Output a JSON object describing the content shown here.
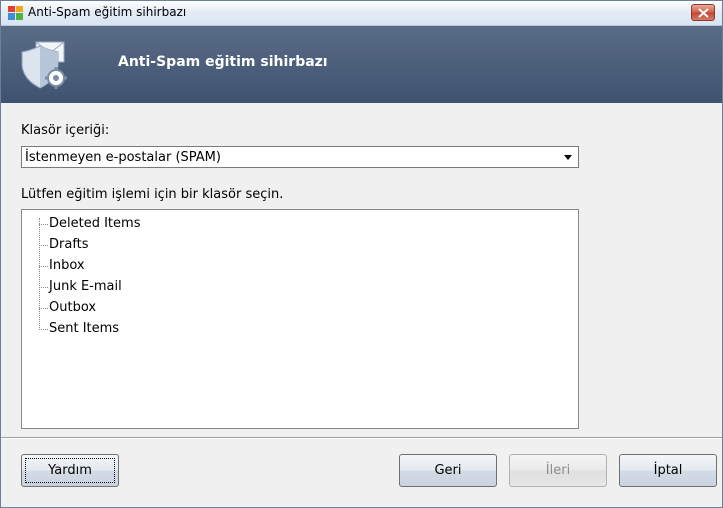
{
  "window": {
    "title": "Anti-Spam eğitim sihirbazı"
  },
  "header": {
    "title": "Anti-Spam eğitim sihirbazı"
  },
  "content": {
    "folder_content_label": "Klasör içeriği:",
    "folder_content_value": "İstenmeyen e-postalar (SPAM)",
    "folder_prompt": "Lütfen eğitim işlemi için bir klasör seçin.",
    "folders": [
      "Deleted Items",
      "Drafts",
      "Inbox",
      "Junk E-mail",
      "Outbox",
      "Sent Items"
    ]
  },
  "buttons": {
    "help": "Yardım",
    "back": "Geri",
    "next": "İleri",
    "cancel": "İptal"
  },
  "colors": {
    "header_bg": "#4a5d7a",
    "header_text": "#ffffff",
    "close_button": "#c9503a"
  },
  "icons": {
    "app": "avg-logo-icon",
    "header": "shield-envelope-gear-icon",
    "close": "close-icon",
    "dropdown": "chevron-down-icon"
  }
}
